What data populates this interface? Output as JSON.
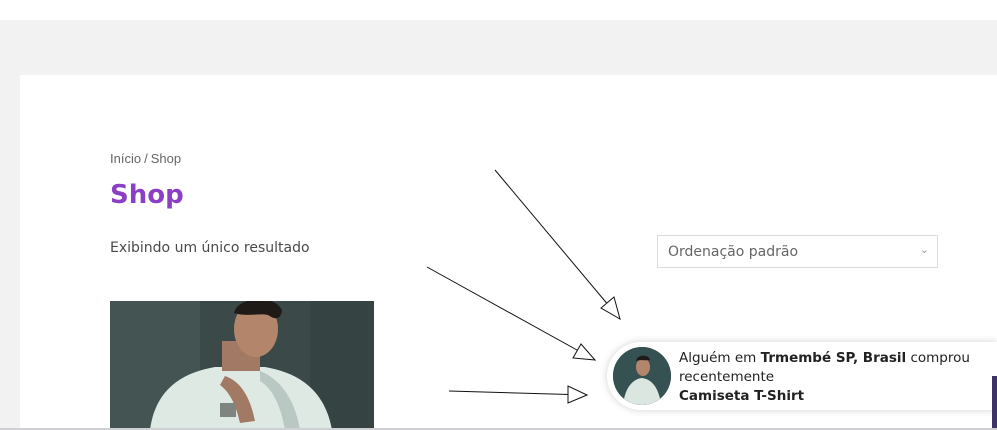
{
  "breadcrumb": {
    "home": "Início",
    "separator": "/",
    "current": "Shop"
  },
  "page": {
    "title": "Shop",
    "result_count": "Exibindo um único resultado"
  },
  "ordering": {
    "selected": "Ordenação padrão",
    "chevron": "chevron-down-icon"
  },
  "popup": {
    "prefix": "Alguém em",
    "location": "Trmembé SP, Brasil",
    "verb": "comprou",
    "time": "recentemente",
    "product": "Camiseta T-Shirt"
  },
  "colors": {
    "accent": "#8a3fc6",
    "band": "#f2f2f3"
  }
}
